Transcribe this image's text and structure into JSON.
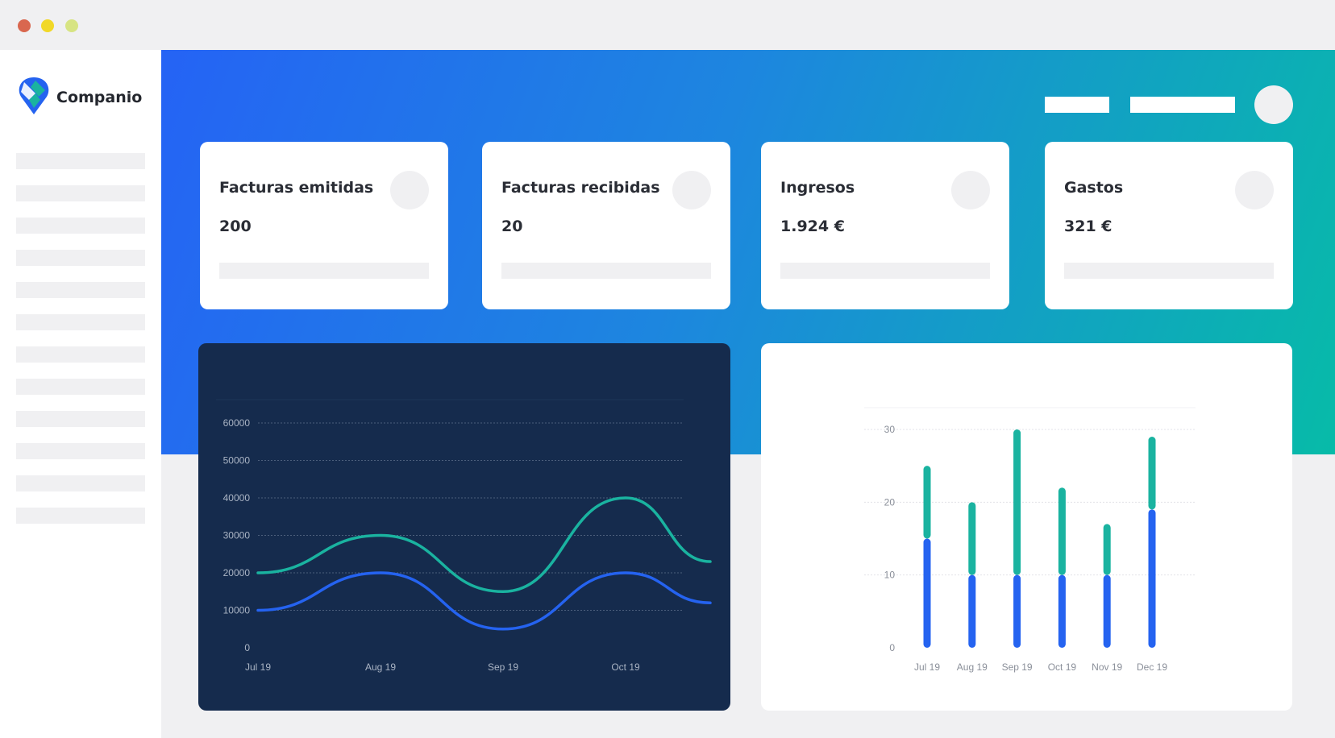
{
  "app": {
    "brand": "Companio",
    "logo_icon": "map-pin-logo-icon"
  },
  "colors": {
    "teal": "#1ab3a0",
    "blue": "#2563f0",
    "dark_panel": "#152b4d"
  },
  "stats": [
    {
      "title": "Facturas emitidas",
      "value": "200"
    },
    {
      "title": "Facturas recibidas",
      "value": "20"
    },
    {
      "title": "Ingresos",
      "value": "1.924 €"
    },
    {
      "title": "Gastos",
      "value": "321 €"
    }
  ],
  "chart_data": [
    {
      "type": "line",
      "x": [
        "Jul 19",
        "Aug 19",
        "Sep 19",
        "Oct 19",
        ""
      ],
      "xticks": [
        "Jul 19",
        "Aug 19",
        "Sep 19",
        "Oct 19"
      ],
      "yticks": [
        0,
        10000,
        20000,
        30000,
        40000,
        50000,
        60000
      ],
      "ylim": [
        0,
        60000
      ],
      "grid": true,
      "series": [
        {
          "color": "#1ab3a0",
          "values": [
            20000,
            30000,
            15000,
            40000,
            23000
          ]
        },
        {
          "color": "#2563f0",
          "values": [
            10000,
            20000,
            5000,
            20000,
            12000
          ]
        }
      ]
    },
    {
      "type": "bar",
      "stacked": true,
      "categories": [
        "Jul 19",
        "Aug 19",
        "Sep 19",
        "Oct 19",
        "Nov 19",
        "Dec 19"
      ],
      "yticks": [
        0,
        10,
        20,
        30
      ],
      "ylim": [
        0,
        30
      ],
      "grid": true,
      "series": [
        {
          "color": "#2563f0",
          "values": [
            15,
            10,
            10,
            10,
            10,
            19
          ]
        },
        {
          "color": "#1ab3a0",
          "values": [
            10,
            10,
            20,
            12,
            7,
            10
          ]
        }
      ]
    }
  ]
}
